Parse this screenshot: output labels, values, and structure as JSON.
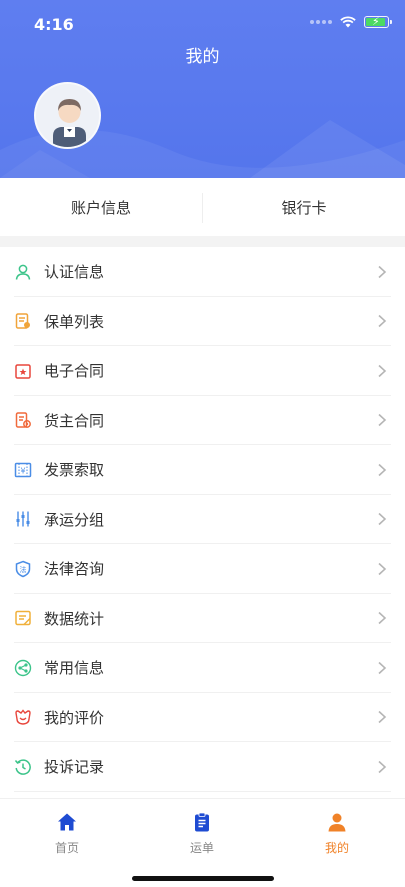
{
  "status_bar": {
    "time": "4:16"
  },
  "header": {
    "title": "我的"
  },
  "account": {
    "info_label": "账户信息",
    "bank_label": "银行卡"
  },
  "menu": {
    "items": [
      {
        "label": "认证信息",
        "icon": "user-icon",
        "color": "#3cc48a"
      },
      {
        "label": "保单列表",
        "icon": "policy-list-icon",
        "color": "#f0a43a"
      },
      {
        "label": "电子合同",
        "icon": "e-contract-icon",
        "color": "#e8463c"
      },
      {
        "label": "货主合同",
        "icon": "shipper-contract-icon",
        "color": "#f06a3c"
      },
      {
        "label": "发票索取",
        "icon": "invoice-icon",
        "color": "#4a8de6"
      },
      {
        "label": "承运分组",
        "icon": "carrier-group-icon",
        "color": "#4a8de6"
      },
      {
        "label": "法律咨询",
        "icon": "legal-shield-icon",
        "color": "#4a8de6"
      },
      {
        "label": "数据统计",
        "icon": "statistics-icon",
        "color": "#f0b03a"
      },
      {
        "label": "常用信息",
        "icon": "share-icon",
        "color": "#3cc48a"
      },
      {
        "label": "我的评价",
        "icon": "review-icon",
        "color": "#e8463c"
      },
      {
        "label": "投诉记录",
        "icon": "history-icon",
        "color": "#3cc48a"
      }
    ]
  },
  "tabbar": {
    "tabs": [
      {
        "label": "首页",
        "icon": "home-icon",
        "active": false
      },
      {
        "label": "运单",
        "icon": "waybill-icon",
        "active": false
      },
      {
        "label": "我的",
        "icon": "profile-icon",
        "active": true
      }
    ],
    "active_color": "#f08228",
    "icon_color": "#1e4bd2"
  }
}
